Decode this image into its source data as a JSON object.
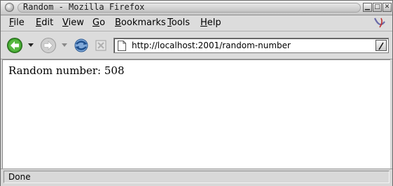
{
  "window": {
    "title": "Random - Mozilla Firefox"
  },
  "menu": [
    {
      "label_underlined": "F",
      "label_rest": "ile"
    },
    {
      "label_underlined": "E",
      "label_rest": "dit"
    },
    {
      "label_underlined": "V",
      "label_rest": "iew"
    },
    {
      "label_underlined": "G",
      "label_rest": "o"
    },
    {
      "label_underlined": "B",
      "label_rest": "ookmarks"
    },
    {
      "label_underlined": "T",
      "label_rest": "ools"
    },
    {
      "label_underlined": "H",
      "label_rest": "elp"
    }
  ],
  "toolbar": {
    "icons": [
      "back-arrow-icon",
      "forward-arrow-icon",
      "reload-icon",
      "stop-icon",
      "page-icon",
      "go-slash-icon"
    ],
    "go_label": "/"
  },
  "address": {
    "url": "http://localhost:2001/random-number"
  },
  "page": {
    "text": "Random number: 508"
  },
  "status": {
    "text": "Done"
  },
  "colors": {
    "back_green": "#3a9a2a",
    "content_bg": "#ffffff",
    "chrome_bg": "#dcdcdc"
  }
}
